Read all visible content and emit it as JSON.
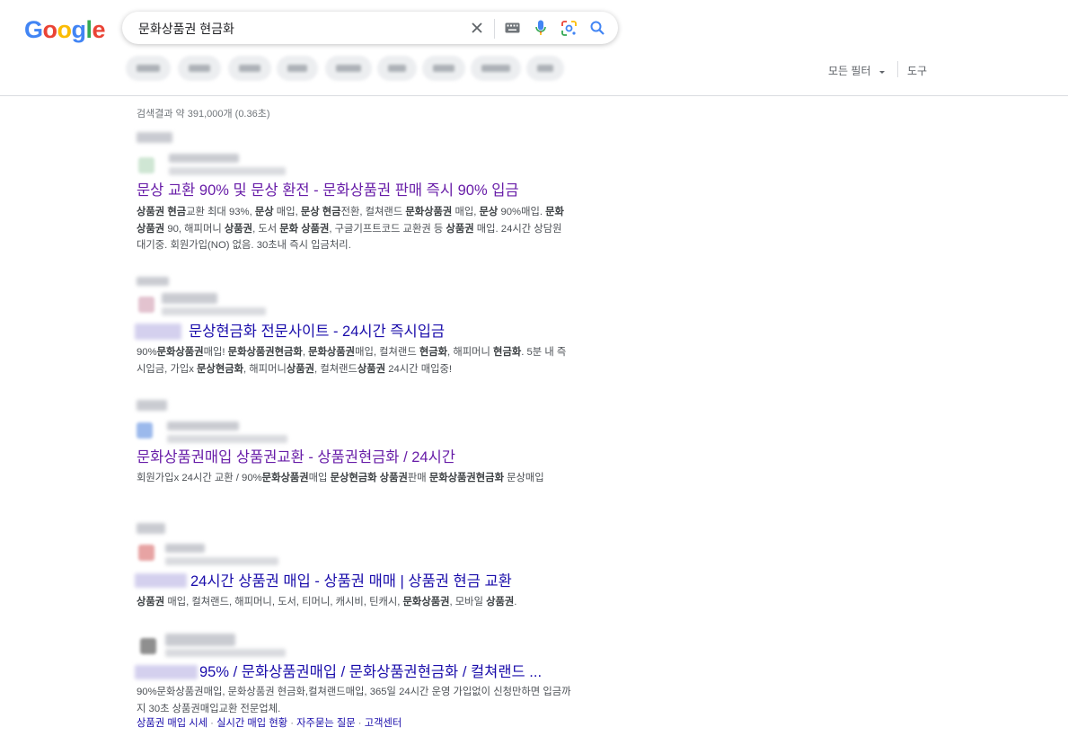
{
  "logo": {
    "text": "Google"
  },
  "search": {
    "query": "문화상품권 현금화"
  },
  "toolbar": {
    "all_filters": "모든 필터",
    "tools": "도구"
  },
  "stats": "검색결과 약 391,000개 (0.36초)",
  "results": [
    {
      "title": "문상 교환 90% 및 문상 환전 - 문화상품권 판매 즉시 90% 입금",
      "snippet_html": "<b>상품권 현금</b>교환 최대 93%, <b>문상</b> 매입, <b>문상 현금</b>전환, 컬쳐랜드 <b>문화상품권</b> 매입, <b>문상</b> 90%매입. <b>문화상품권</b> 90, 해피머니 <b>상품권</b>, 도서 <b>문화 상품권</b>, 구글기프트코드 교환권 등 <b>상품권</b> 매입. 24시간 상담원 대기중. 회원가입(NO) 없음. 30초내 즉시 입금처리."
    },
    {
      "title": "문상현금화 전문사이트 - 24시간 즉시입금",
      "snippet_html": "90%<b>문화상품권</b>매입! <b>문화상품권현금화</b>, <b>문화상품권</b>매입, 컬쳐랜드 <b>현금화</b>, 해피머니 <b>현금화</b>. 5분 내 즉시입금, 가입x <b>문상현금화</b>, 해피머니<b>상품권</b>, 컬쳐랜드<b>상품권</b> 24시간 매입중!"
    },
    {
      "title": "문화상품권매입 상품권교환 - 상품권현금화 / 24시간",
      "snippet_html": "회원가입x 24시간 교환 / 90%<b>문화상품권</b>매입 <b>문상현금화 상품권</b>판매 <b>문화상품권현금화</b> 문상매입"
    },
    {
      "title": "24시간 상품권 매입 - 상품권 매매 | 상품권 현금 교환",
      "snippet_html": "<b>상품권</b> 매입, 컬쳐랜드, 해피머니, 도서, 티머니, 캐시비, 틴캐시, <b>문화상품권</b>, 모바일 <b>상품권</b>."
    },
    {
      "title": "95% / 문화상품권매입 / 문화상품권현금화 / 컬쳐랜드 ...",
      "snippet_html": "90%문화상품권매입, 문화상품권 현금화,컬쳐랜드매입, 365일 24시간 운영 가입없이 신청만하면 입금까지 30초 상품권매입교환 전문업체.",
      "sitelinks": [
        "상품권 매입 시세",
        "실시간 매입 현황",
        "자주묻는 질문",
        "고객센터"
      ]
    }
  ],
  "sitelink_separator": " · ",
  "colors": {
    "visited": "#681da8",
    "link": "#1a0dab",
    "snippet": "#4d5156"
  },
  "icons": [
    "clear-icon",
    "keyboard-icon",
    "mic-icon",
    "lens-icon",
    "search-icon",
    "caret-down-icon"
  ]
}
